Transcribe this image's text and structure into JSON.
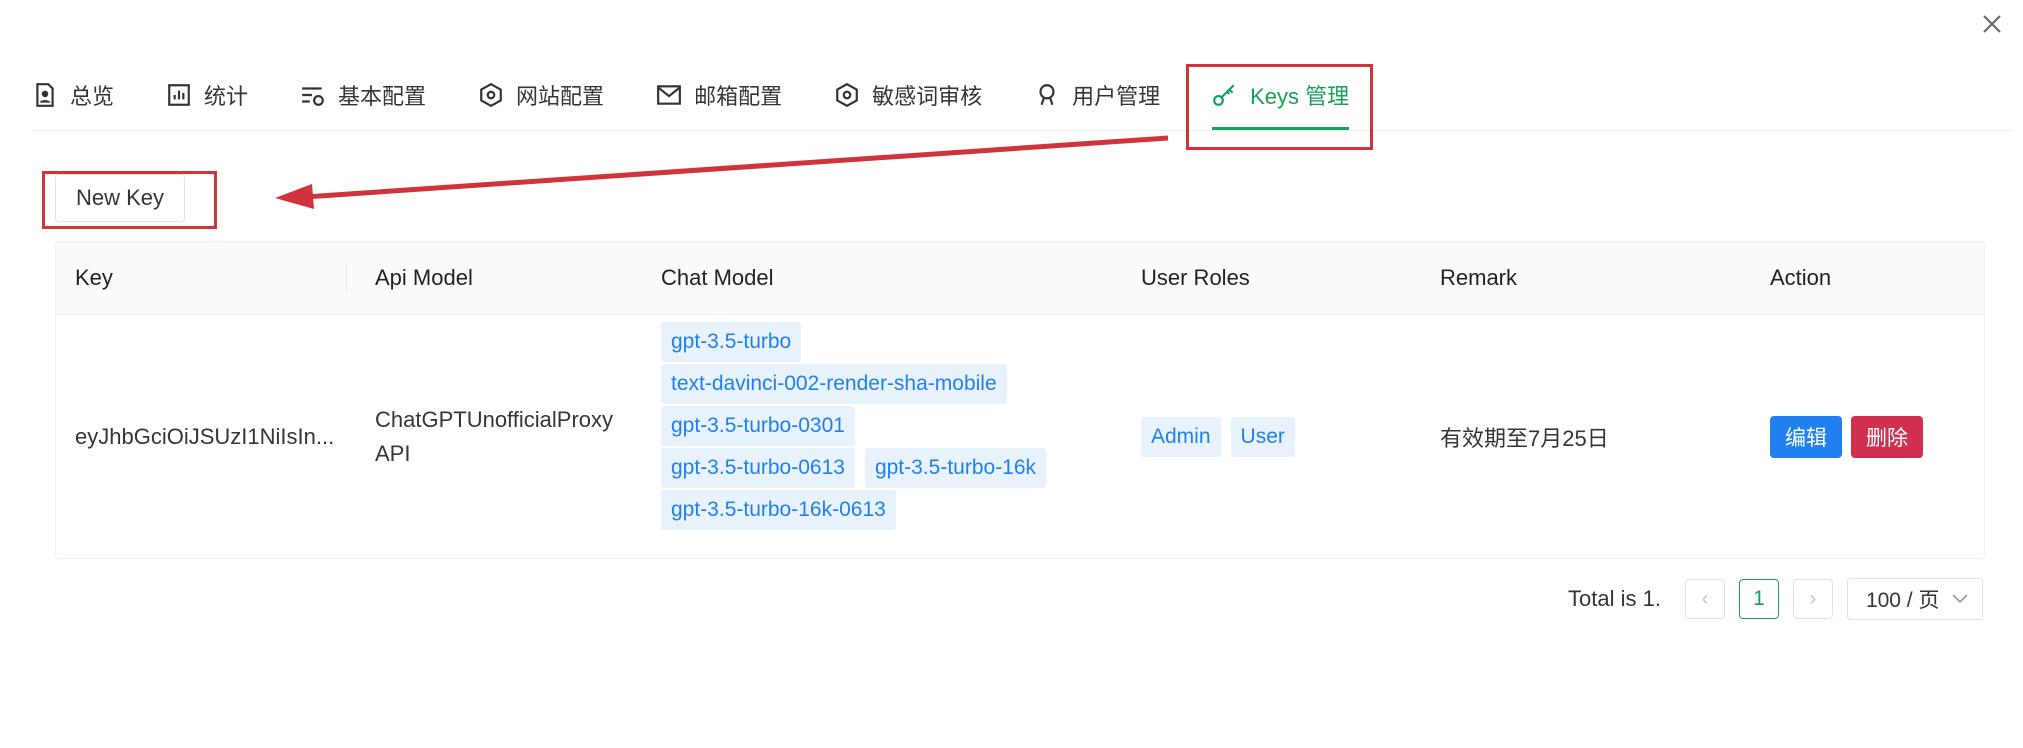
{
  "tabs": [
    {
      "label": "总览",
      "icon": "file-user-icon"
    },
    {
      "label": "统计",
      "icon": "bar-chart-icon"
    },
    {
      "label": "基本配置",
      "icon": "settings-list-icon"
    },
    {
      "label": "网站配置",
      "icon": "hexagon-settings-icon"
    },
    {
      "label": "邮箱配置",
      "icon": "mail-icon"
    },
    {
      "label": "敏感词审核",
      "icon": "hexagon-settings-icon"
    },
    {
      "label": "用户管理",
      "icon": "user-icon"
    },
    {
      "label": "Keys 管理",
      "icon": "key-icon",
      "active": true
    }
  ],
  "toolbar": {
    "new_key_label": "New Key"
  },
  "table": {
    "columns": [
      "Key",
      "Api Model",
      "Chat Model",
      "User Roles",
      "Remark",
      "Action"
    ],
    "rows": [
      {
        "key": "eyJhbGciOiJSUzI1NiIsIn...",
        "api_model": "ChatGPTUnofficialProxy API",
        "chat_models": [
          [
            "gpt-3.5-turbo"
          ],
          [
            "text-davinci-002-render-sha-mobile"
          ],
          [
            "gpt-3.5-turbo-0301"
          ],
          [
            "gpt-3.5-turbo-0613",
            "gpt-3.5-turbo-16k"
          ],
          [
            "gpt-3.5-turbo-16k-0613"
          ]
        ],
        "user_roles": [
          "Admin",
          "User"
        ],
        "remark": "有效期至7月25日",
        "edit_label": "编辑",
        "delete_label": "删除"
      }
    ]
  },
  "pagination": {
    "total_text": "Total is 1.",
    "current_page": "1",
    "page_size": "100 / 页"
  },
  "colors": {
    "accent": "#18a058",
    "tag_bg": "#e8f2fc",
    "tag_text": "#2080f0",
    "edit": "#2080f0",
    "delete": "#d03050",
    "annotation": "#d0333a"
  }
}
